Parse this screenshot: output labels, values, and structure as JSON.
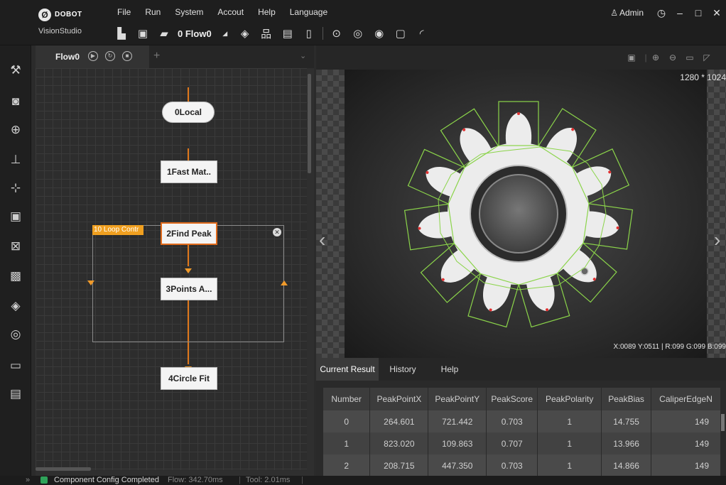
{
  "app": {
    "brand": "DOBOT",
    "product": "VisionStudio"
  },
  "menu": [
    "File",
    "Run",
    "System",
    "Accout",
    "Help",
    "Language"
  ],
  "toolbar": {
    "flow_select": "0 Flow0"
  },
  "user": {
    "name": "Admin"
  },
  "flow": {
    "tab_name": "Flow0",
    "nodes": [
      {
        "label": "0Local"
      },
      {
        "label": "1Fast Mat.."
      },
      {
        "label": "2Find Peak"
      },
      {
        "label": "3Points A..."
      },
      {
        "label": "4Circle Fit"
      }
    ],
    "loop_label": "10 Loop Contr"
  },
  "image": {
    "size": "1280 * 1024",
    "coords": "X:0089 Y:0511 | R:099 G:099 B:099"
  },
  "results": {
    "tabs": [
      "Current Result",
      "History",
      "Help"
    ],
    "columns": [
      "Number",
      "PeakPointX",
      "PeakPointY",
      "PeakScore",
      "PeakPolarity",
      "PeakBias",
      "CaliperEdgeN"
    ],
    "rows": [
      [
        "0",
        "264.601",
        "721.442",
        "0.703",
        "1",
        "14.755",
        "149"
      ],
      [
        "1",
        "823.020",
        "109.863",
        "0.707",
        "1",
        "13.966",
        "149"
      ],
      [
        "2",
        "208.715",
        "447.350",
        "0.703",
        "1",
        "14.866",
        "149"
      ]
    ]
  },
  "status": {
    "message": "Component Config Completed",
    "flow_time": "Flow: 342.70ms",
    "tool_time": "Tool: 2.01ms"
  },
  "colors": {
    "accent": "#e0781b",
    "loop": "#f0a020",
    "roi": "#8bd44a"
  }
}
